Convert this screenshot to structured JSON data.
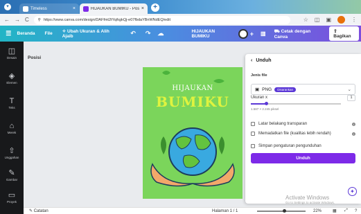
{
  "browser": {
    "tabs": [
      {
        "label": "Timeless",
        "active": false
      },
      {
        "label": "HIJAUKAN BUMIKU - Poster",
        "active": true
      }
    ],
    "url": "https://www.canva.com/design/DAFfmt2tYq/kgkQj-e07fbdaYBnWNdEQ/edit"
  },
  "canva": {
    "menu": {
      "home": "Beranda",
      "file": "File",
      "resize": "Ubah Ukuran & Alih Ajaib"
    },
    "design_title": "HIJAUKAN BUMIKU",
    "print_label": "Cetak dengan Canva",
    "share_label": "Bagikan"
  },
  "sidebar": {
    "items": [
      {
        "label": "Desain",
        "icon": "layout-icon"
      },
      {
        "label": "Elemen",
        "icon": "shapes-icon"
      },
      {
        "label": "Teks",
        "icon": "text-icon"
      },
      {
        "label": "Merek",
        "icon": "brand-icon"
      },
      {
        "label": "Unggahan",
        "icon": "upload-icon"
      },
      {
        "label": "Gambar",
        "icon": "draw-icon"
      },
      {
        "label": "Proyek",
        "icon": "folder-icon"
      }
    ]
  },
  "editor": {
    "position_label": "Posisi",
    "poster": {
      "line1": "HIJAUKAN",
      "line2": "BUMIKU"
    }
  },
  "download_panel": {
    "title": "Unduh",
    "file_type_label": "Jenis file",
    "file_type_value": "PNG",
    "file_type_badge": "Disarankan",
    "size_label": "Ukuran x",
    "size_value": "1",
    "size_fraction": 0.17,
    "dimensions": "1.587 × 2.245 piksel",
    "options": [
      "Latar belakang transparan",
      "Memadatkan file (kualitas lebih rendah)",
      "Simpan pengaturan pengunduhan"
    ],
    "download_button": "Unduh"
  },
  "bottom": {
    "notes": "Catatan",
    "page_info": "Halaman 1 / 1",
    "zoom": "22%"
  },
  "watermark": {
    "line1": "Activate Windows",
    "line2": "Go to Settings to activate Windows."
  },
  "colors": {
    "poster_bg": "#7bd55b",
    "accent": "#7d2ae8",
    "toolbar_start": "#22b5c5",
    "toolbar_end": "#7c4ddd"
  }
}
